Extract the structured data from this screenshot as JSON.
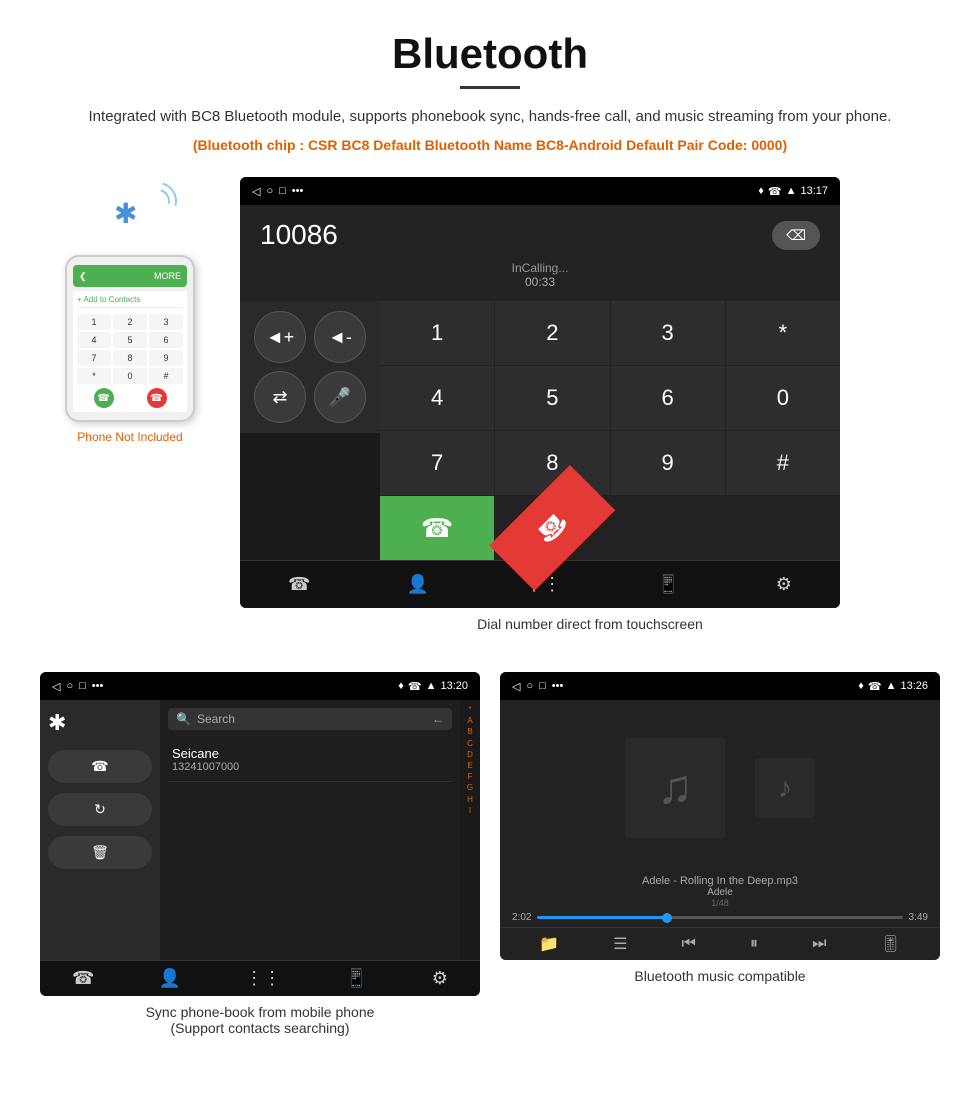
{
  "page": {
    "title": "Bluetooth",
    "title_underline": true,
    "description": "Integrated with BC8 Bluetooth module, supports phonebook sync, hands-free call, and music streaming from your phone.",
    "bluetooth_info": "(Bluetooth chip : CSR BC8    Default Bluetooth Name BC8-Android    Default Pair Code: 0000)"
  },
  "phone_illustration": {
    "not_included_label": "Phone Not Included",
    "top_bar_text": "MORE",
    "add_contacts_text": "+ Add to Contacts",
    "dial_keys": [
      "1",
      "2",
      "3",
      "4",
      "5",
      "6",
      "7",
      "8",
      "9",
      "*",
      "0",
      "#"
    ]
  },
  "dial_screen": {
    "status_time": "13:17",
    "status_icons": "♦ ℃ ▲",
    "nav_back": "◁",
    "nav_home": "○",
    "nav_square": "□",
    "number": "10086",
    "delete_label": "⌫",
    "in_calling": "InCalling...",
    "timer": "00:33",
    "keypad": [
      "1",
      "2",
      "3",
      "*",
      "4",
      "5",
      "6",
      "0",
      "7",
      "8",
      "9",
      "#"
    ],
    "call_answer_icon": "📞",
    "call_end_icon": "📞",
    "caption": "Dial number direct from touchscreen"
  },
  "phonebook_screen": {
    "status_time": "13:20",
    "search_placeholder": "Search",
    "contact_name": "Seicane",
    "contact_number": "13241007000",
    "alphabet_letters": [
      "*",
      "A",
      "B",
      "C",
      "D",
      "E",
      "F",
      "G",
      "H",
      "I"
    ],
    "caption_line1": "Sync phone-book from mobile phone",
    "caption_line2": "(Support contacts searching)"
  },
  "music_screen": {
    "status_time": "13:26",
    "track_name": "Adele - Rolling In the Deep.mp3",
    "artist": "Adele",
    "track_count": "1/48",
    "time_current": "2:02",
    "time_total": "3:49",
    "caption": "Bluetooth music compatible"
  },
  "icons": {
    "bluetooth": "₿",
    "phone": "📞",
    "music_note": "♪",
    "search": "🔍",
    "gear": "⚙",
    "volume_up": "🔊",
    "volume_down": "🔉",
    "shuffle": "⇌",
    "mic": "🎤",
    "prev": "⏮",
    "play": "⏸",
    "next": "⏭",
    "settings": "⚙"
  }
}
